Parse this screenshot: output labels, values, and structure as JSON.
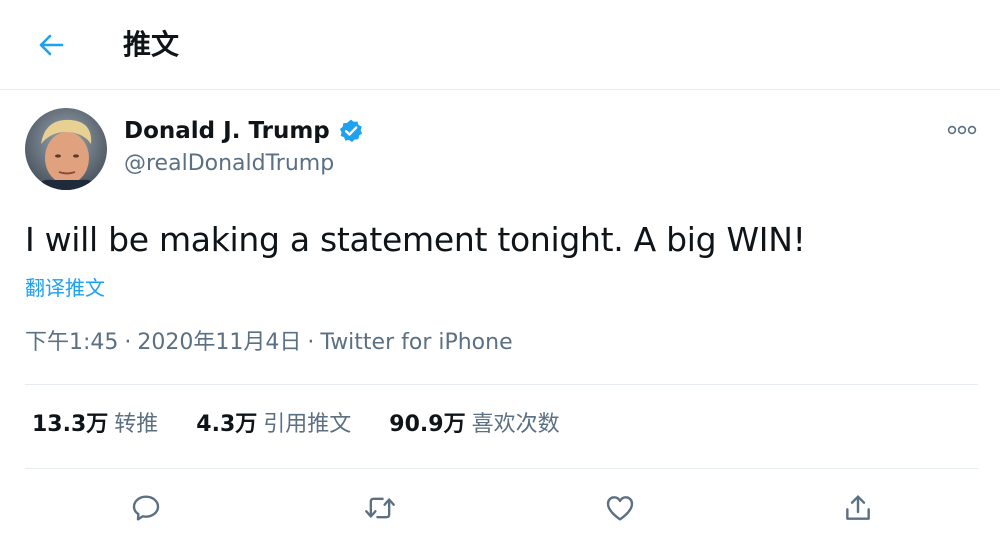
{
  "header": {
    "title": "推文",
    "back_icon": "arrow-left-icon"
  },
  "author": {
    "display_name": "Donald J. Trump",
    "handle": "@realDonaldTrump",
    "verified": true
  },
  "tweet": {
    "text": "I will be making a statement tonight. A big WIN!",
    "translate_label": "翻译推文",
    "time": "下午1:45",
    "date": "2020年11月4日",
    "source": "Twitter for iPhone",
    "dot": "·"
  },
  "stats": {
    "retweets_count": "13.3万",
    "retweets_label": "转推",
    "quotes_count": "4.3万",
    "quotes_label": "引用推文",
    "likes_count": "90.9万",
    "likes_label": "喜欢次数"
  },
  "actions": [
    "reply-icon",
    "retweet-icon",
    "like-icon",
    "share-icon"
  ],
  "colors": {
    "accent": "#1da1f2",
    "text": "#0f1419",
    "secondary": "#5b7083",
    "divider": "#e6ecf0"
  }
}
